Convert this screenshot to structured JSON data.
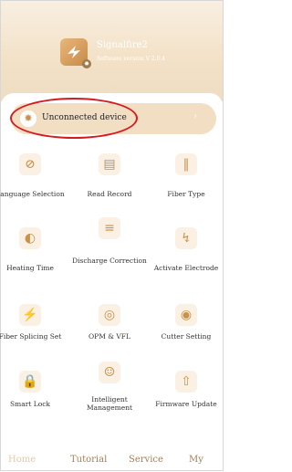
{
  "app": {
    "name": "Signalfire2",
    "version_text": "Software version  V 2.0.4"
  },
  "connection": {
    "label": "Unconnected device",
    "arrow": "›",
    "icon": "bluetooth-icon"
  },
  "grid": {
    "items": [
      {
        "label": "Language Selection",
        "icon": "language-icon"
      },
      {
        "label": "Read Record",
        "icon": "record-icon"
      },
      {
        "label": "Fiber Type",
        "icon": "fiber-type-icon"
      },
      {
        "label": "Heating Time",
        "icon": "heating-icon"
      },
      {
        "label": "Discharge Correction",
        "icon": "discharge-icon"
      },
      {
        "label": "Activate Electrode",
        "icon": "electrode-icon"
      },
      {
        "label": "Fiber Splicing Set",
        "icon": "splicing-icon"
      },
      {
        "label": "OPM & VFL",
        "icon": "opm-icon"
      },
      {
        "label": "Cutter Setting",
        "icon": "cutter-icon"
      },
      {
        "label": "Smart Lock",
        "icon": "lock-icon"
      },
      {
        "label": "Intelligent Management",
        "icon": "management-icon"
      },
      {
        "label": "Firmware Update",
        "icon": "update-icon"
      }
    ]
  },
  "tabs": {
    "home": "Home",
    "tutorial": "Tutorial",
    "service": "Service",
    "my": "My"
  },
  "colors": {
    "accent": "#c8924b",
    "header": "#f3e2c8",
    "active_tab": "#e8c9a6",
    "highlight": "#d51a21"
  }
}
